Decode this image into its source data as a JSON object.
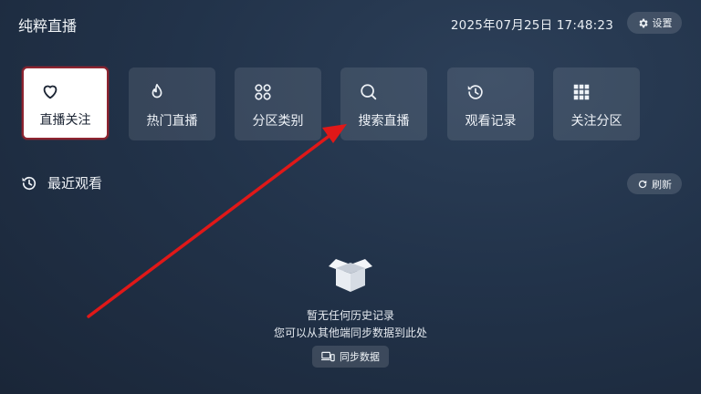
{
  "header": {
    "app_title": "纯粹直播",
    "datetime": "2025年07月25日 17:48:23",
    "settings_label": "设置",
    "settings_icon": "gear-icon"
  },
  "tiles": [
    {
      "label": "直播关注",
      "icon": "heart-icon",
      "active": true
    },
    {
      "label": "热门直播",
      "icon": "flame-icon",
      "active": false
    },
    {
      "label": "分区类别",
      "icon": "category-grid-icon",
      "active": false
    },
    {
      "label": "搜索直播",
      "icon": "search-icon",
      "active": false
    },
    {
      "label": "观看记录",
      "icon": "history-icon",
      "active": false
    },
    {
      "label": "关注分区",
      "icon": "apps-grid-icon",
      "active": false
    }
  ],
  "recent": {
    "title": "最近观看",
    "icon": "history-icon",
    "refresh_label": "刷新",
    "refresh_icon": "refresh-icon",
    "empty_icon": "empty-box-icon",
    "empty_line1": "暂无任何历史记录",
    "empty_line2": "您可以从其他端同步数据到此处",
    "sync_label": "同步数据",
    "sync_icon": "devices-icon"
  },
  "colors": {
    "active_tile_border": "#8e2430",
    "annotation_arrow": "#e01818"
  }
}
